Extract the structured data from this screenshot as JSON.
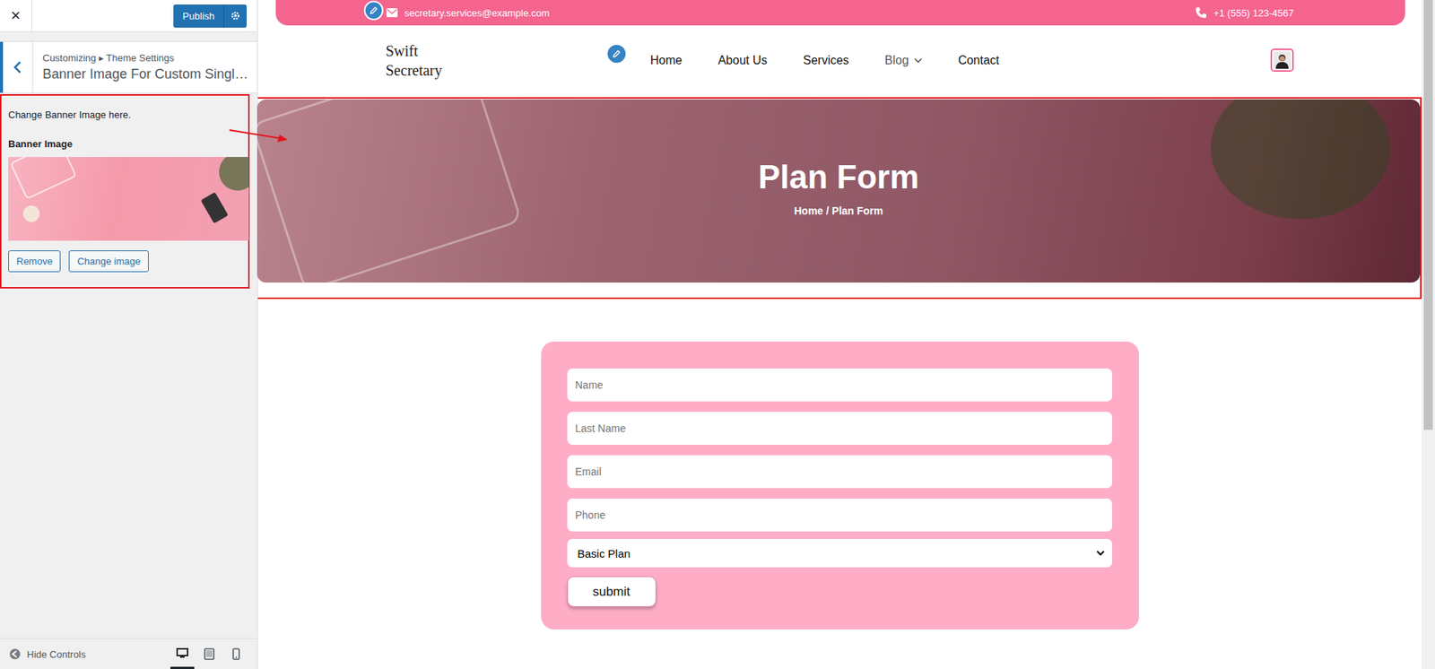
{
  "customizer": {
    "close": "×",
    "publish": "Publish",
    "breadcrumb": "Customizing ▸ Theme Settings",
    "section_title": "Banner Image For Custom Singl…",
    "description": "Change Banner Image here.",
    "control_label": "Banner Image",
    "buttons": [
      "Remove",
      "Change image"
    ],
    "hide_controls": "Hide Controls",
    "devices": [
      {
        "kind": "desktop",
        "selected": true
      },
      {
        "kind": "tablet",
        "selected": false
      },
      {
        "kind": "mobile",
        "selected": false
      }
    ]
  },
  "topbar": {
    "email": "secretary.services@example.com",
    "phone": "+1 (555) 123-4567"
  },
  "site": {
    "logo_lines": [
      "Swift",
      "Secretary"
    ]
  },
  "nav": [
    {
      "label": "Home",
      "dropdown": false
    },
    {
      "label": "About Us",
      "dropdown": false
    },
    {
      "label": "Services",
      "dropdown": false
    },
    {
      "label": "Blog",
      "dropdown": true
    },
    {
      "label": "Contact",
      "dropdown": false
    }
  ],
  "banner": {
    "title": "Plan Form",
    "breadcrumb": "Home / Plan Form"
  },
  "form": {
    "fields": [
      {
        "placeholder": "Name"
      },
      {
        "placeholder": "Last Name"
      },
      {
        "placeholder": "Email"
      },
      {
        "placeholder": "Phone"
      }
    ],
    "select": "Basic Plan",
    "submit": "submit"
  }
}
